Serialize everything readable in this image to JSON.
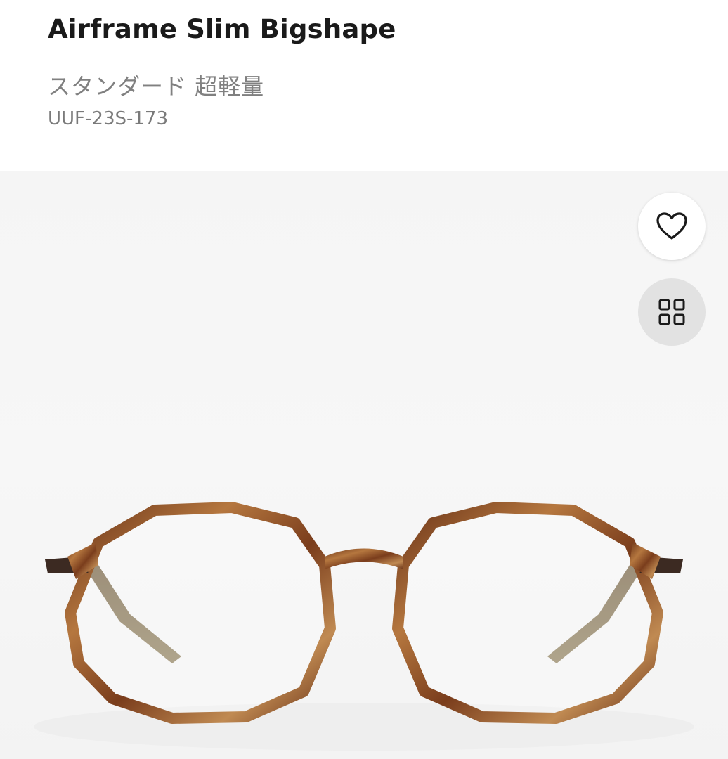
{
  "product": {
    "title": "Airframe Slim Bigshape",
    "subtitle": "スタンダード 超軽量",
    "code": "UUF-23S-173"
  },
  "actions": {
    "favorite_icon": "heart-icon",
    "view_icon": "grid-icon"
  },
  "colors": {
    "frame_tortoise": "#8a4a24",
    "temple_olive": "#7a6a4a"
  }
}
